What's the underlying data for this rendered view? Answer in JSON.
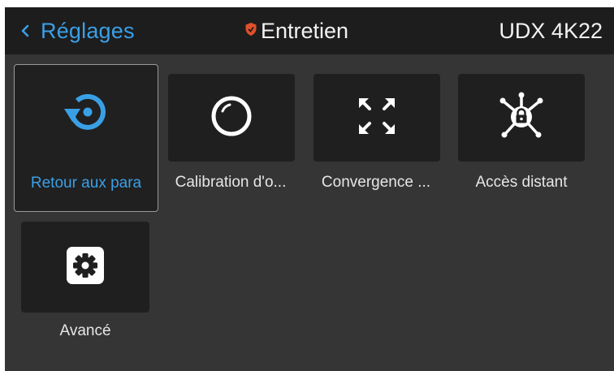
{
  "header": {
    "back_label": "Réglages",
    "title": "Entretien",
    "device": "UDX 4K22"
  },
  "tiles": [
    {
      "label": "Retour aux para",
      "icon": "restore-icon",
      "selected": true
    },
    {
      "label": "Calibration d'o...",
      "icon": "circle-icon",
      "selected": false
    },
    {
      "label": "Convergence ...",
      "icon": "expand-arrows-icon",
      "selected": false
    },
    {
      "label": "Accès distant",
      "icon": "remote-access-lock-icon",
      "selected": false
    },
    {
      "label": "Avancé",
      "icon": "gear-icon",
      "selected": false
    }
  ],
  "colors": {
    "accent": "#3aa0e6",
    "header_bg": "#1d1d1d",
    "screen_bg": "#353535",
    "tile_bg": "#1f1f1f",
    "shield": "#e0502a"
  }
}
